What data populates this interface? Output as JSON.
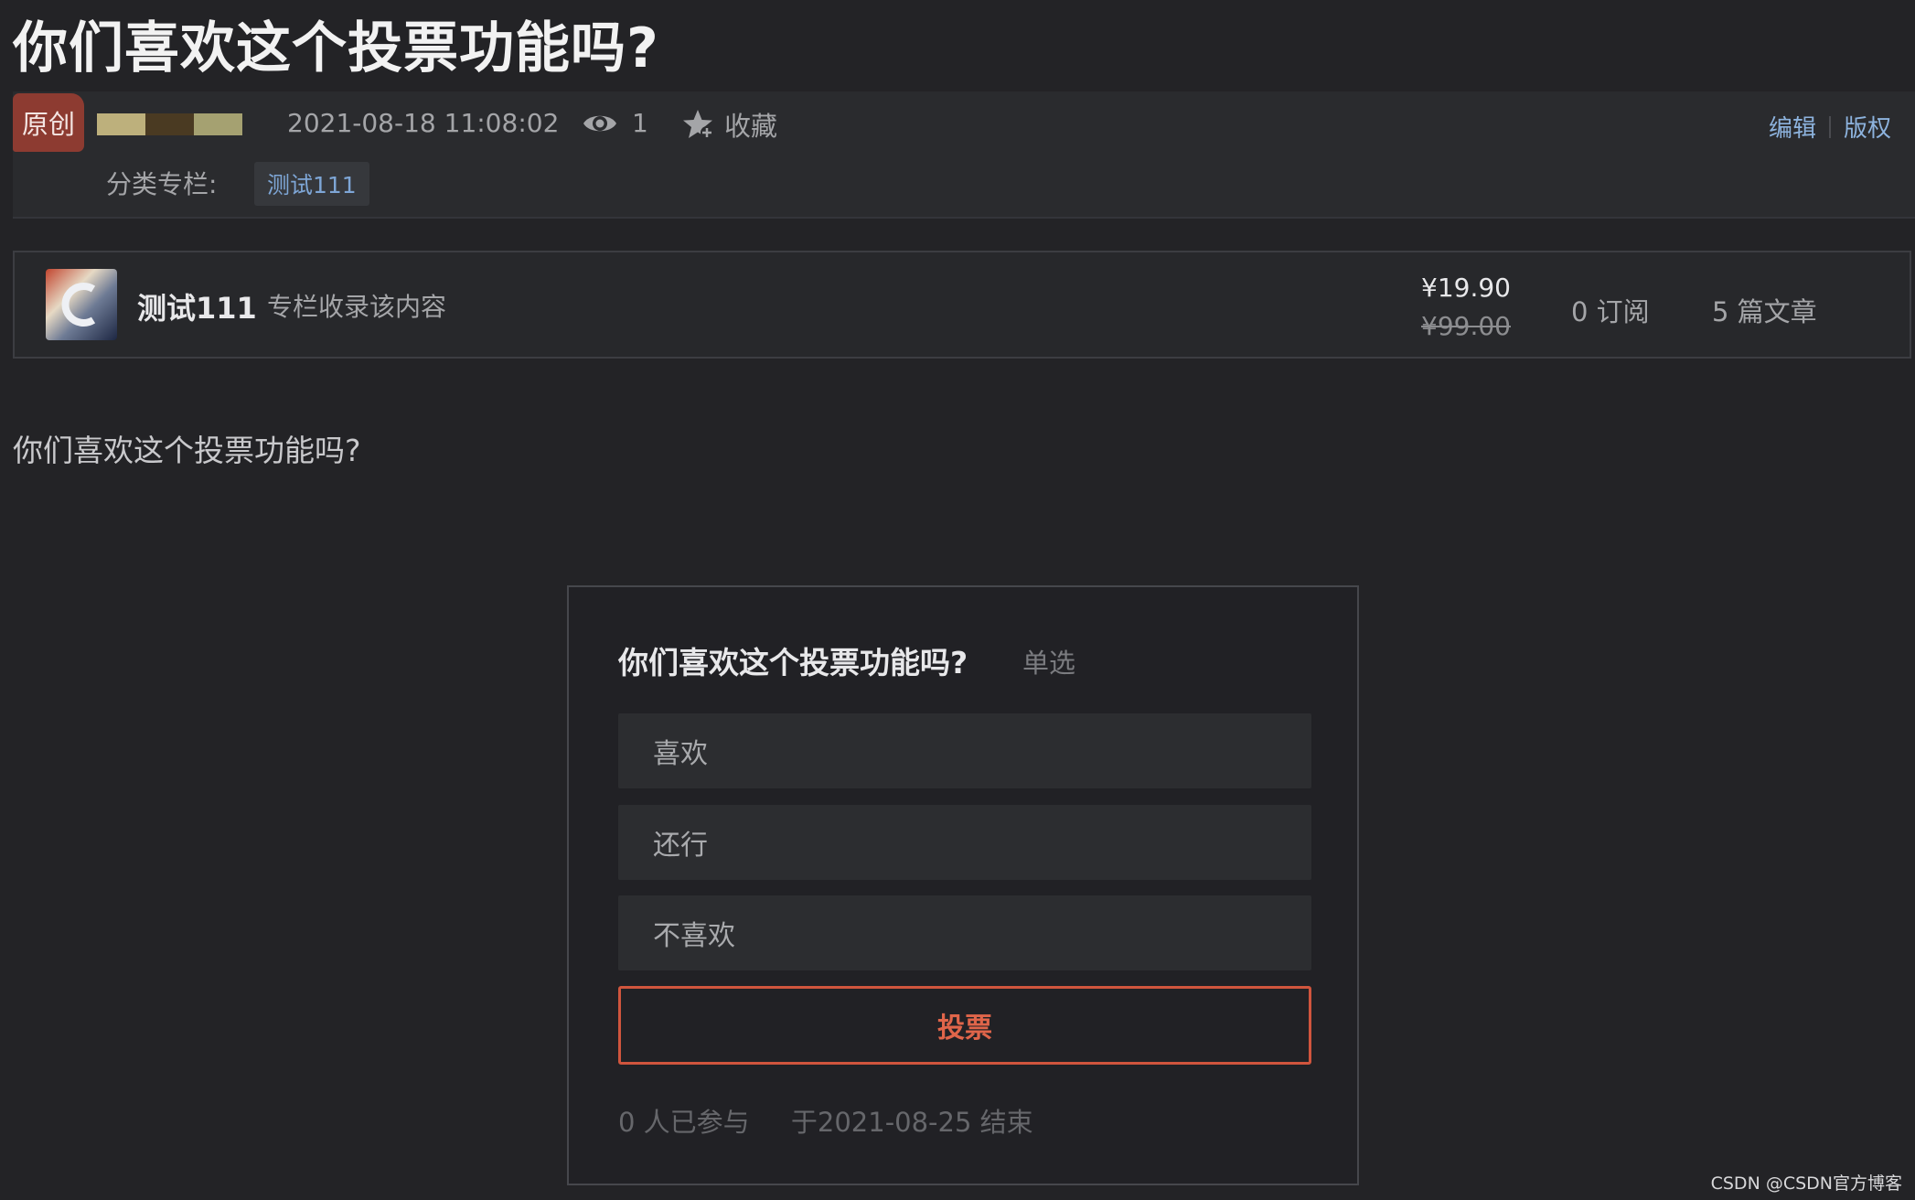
{
  "article": {
    "title": "你们喜欢这个投票功能吗?",
    "badge": "原创",
    "date": "2021-08-18 11:08:02",
    "views": "1",
    "favorite_label": "收藏",
    "edit_link": "编辑",
    "copyright_link": "版权",
    "category_label": "分类专栏:",
    "category_tag": "测试111",
    "body_text": "你们喜欢这个投票功能吗?"
  },
  "column": {
    "name": "测试111",
    "description": "专栏收录该内容",
    "price": "¥19.90",
    "original_price": "¥99.00",
    "subscriptions": "0 订阅",
    "articles": "5 篇文章"
  },
  "poll": {
    "question": "你们喜欢这个投票功能吗?",
    "type": "单选",
    "options": [
      "喜欢",
      "还行",
      "不喜欢"
    ],
    "vote_button": "投票",
    "participants": "0 人已参与",
    "end_text": "于2021-08-25 结束"
  },
  "watermark": "CSDN @CSDN官方博客",
  "colors": {
    "background": "#232326",
    "accent_orange": "#e0654a",
    "link_blue": "#8db3de",
    "badge_red": "#8d3b31"
  },
  "icons": {
    "views": "eye-icon",
    "favorite": "star-icon"
  }
}
